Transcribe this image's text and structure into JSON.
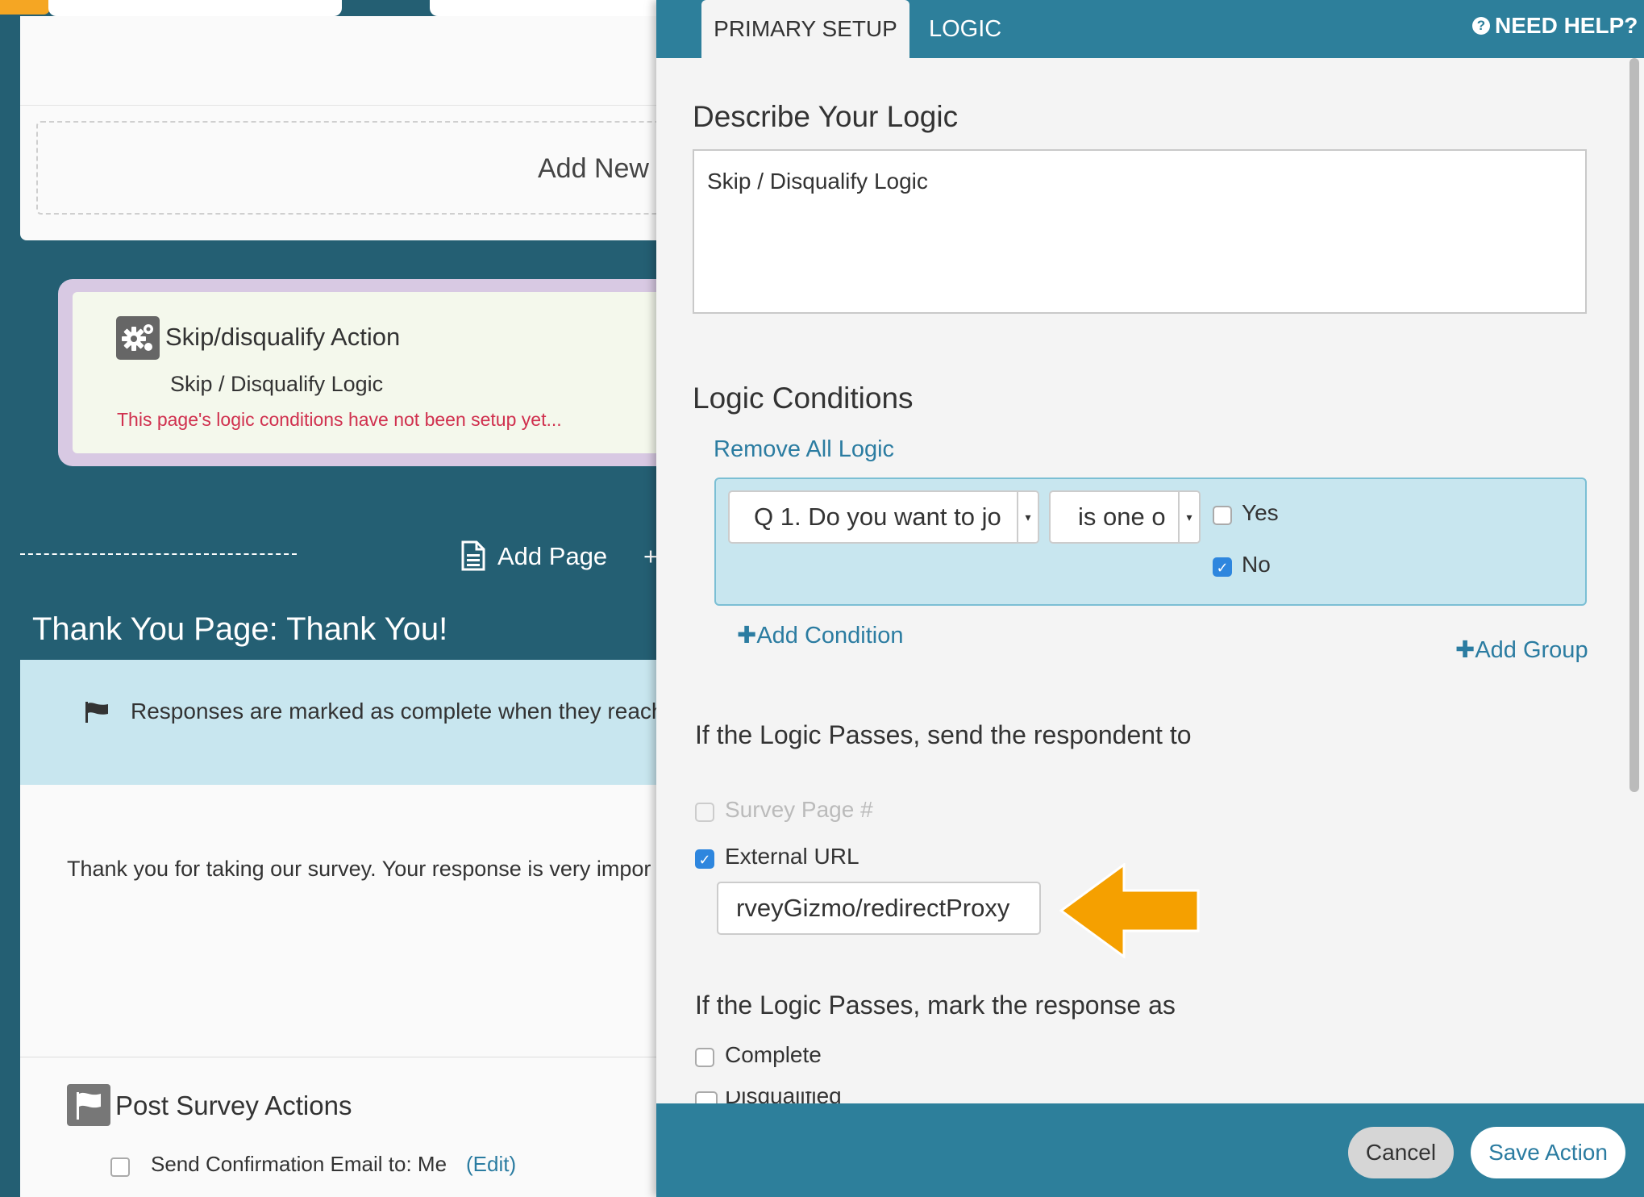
{
  "background": {
    "add_new_label": "Add New",
    "action": {
      "title": "Skip/disqualify Action",
      "subtitle": "Skip / Disqualify Logic",
      "warning": "This page's logic conditions have not been setup yet..."
    },
    "add_page_label": "Add Page",
    "add_page_plus": "+",
    "thank_you_title": "Thank You Page: Thank You!",
    "banner_text": "Responses are marked as complete when they reach",
    "thank_you_text": "Thank you for taking our survey. Your response is very impor",
    "post_survey": {
      "title": "Post Survey Actions",
      "email_label": "Send Confirmation Email to: Me",
      "edit_label": "(Edit)"
    }
  },
  "panel": {
    "tabs": [
      {
        "label": "PRIMARY SETUP",
        "active": true
      },
      {
        "label": "LOGIC",
        "active": false
      }
    ],
    "help_label": "NEED HELP?",
    "help_glyph": "?",
    "describe": {
      "heading": "Describe Your Logic",
      "value": "Skip / Disqualify Logic"
    },
    "conditions": {
      "heading": "Logic Conditions",
      "remove_all": "Remove All Logic",
      "question_select": "Q 1. Do you want to jo",
      "operator_select": "is one o",
      "options": [
        {
          "label": "Yes",
          "checked": false
        },
        {
          "label": "No",
          "checked": true
        }
      ],
      "add_condition": "Add Condition",
      "add_group": "Add Group"
    },
    "passes_send": {
      "heading": "If the Logic Passes, send the respondent to",
      "survey_page_label": "Survey Page #",
      "survey_page_checked": false,
      "external_url_label": "External URL",
      "external_url_checked": true,
      "external_url_value": "rveyGizmo/redirectProxy"
    },
    "passes_mark": {
      "heading": "If the Logic Passes, mark the response as",
      "complete_label": "Complete",
      "disqualified_label": "Disqualified"
    },
    "footer": {
      "cancel_label": "Cancel",
      "save_label": "Save Action"
    }
  },
  "colors": {
    "teal_bg": "#245f73",
    "panel_header": "#2d7f9b",
    "link_blue": "#2b7ca1",
    "condition_bg": "#c8e6ef",
    "warning_red": "#d0304e",
    "arrow_orange": "#f5a000"
  },
  "icons": [
    "gear-icon",
    "page-icon",
    "flag-icon",
    "help-icon",
    "plus-icon",
    "dropdown-caret-icon",
    "arrow-pointer-icon"
  ]
}
